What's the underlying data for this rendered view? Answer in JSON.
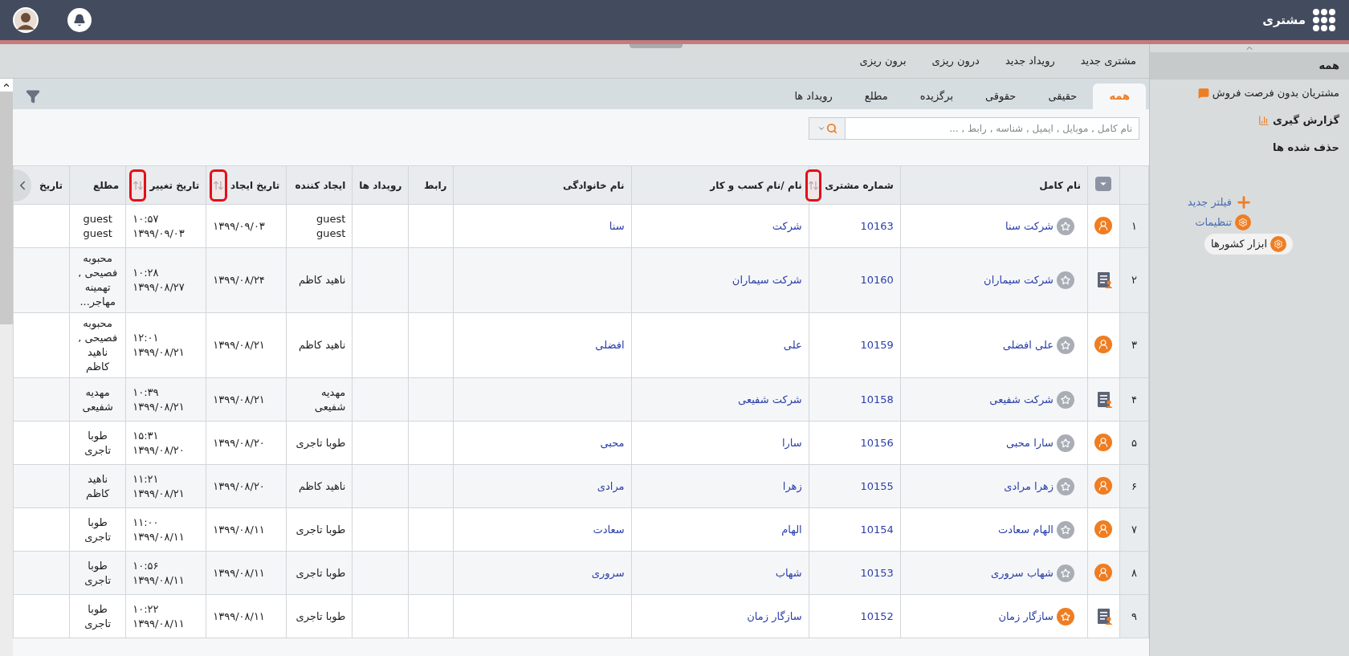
{
  "app": {
    "title": "مشتری"
  },
  "sidebar": {
    "items": [
      {
        "label": "همه",
        "selected": true,
        "kind": "plain"
      },
      {
        "label": "مشتریان بدون فرصت فروش",
        "selected": false,
        "kind": "chat"
      },
      {
        "label": "گزارش گیری",
        "selected": false,
        "kind": "report"
      },
      {
        "label": "حذف شده ها",
        "selected": false,
        "kind": "bold"
      }
    ],
    "links": [
      {
        "label": "فیلتر جدید",
        "kind": "add"
      },
      {
        "label": "تنظیمات",
        "kind": "settings"
      },
      {
        "label": "ابزار کشورها",
        "kind": "tool"
      }
    ]
  },
  "toolbar": [
    "مشتری جدید",
    "رویداد جدید",
    "درون ریزی",
    "برون ریزی"
  ],
  "tabs": [
    {
      "label": "همه",
      "selected": true
    },
    {
      "label": "حقیقی",
      "selected": false
    },
    {
      "label": "حقوقی",
      "selected": false
    },
    {
      "label": "برگزیده",
      "selected": false
    },
    {
      "label": "مطلع",
      "selected": false
    },
    {
      "label": "رویداد ها",
      "selected": false
    }
  ],
  "search": {
    "placeholder": "نام کامل , موبایل , ایمیل , شناسه , رابط , ..."
  },
  "table": {
    "columns": [
      {
        "label": "نام کامل",
        "sortable": false
      },
      {
        "label": "شماره مشتری",
        "sortable": true,
        "highlighted": true
      },
      {
        "label": "نام /نام کسب و کار",
        "sortable": false
      },
      {
        "label": "نام خانوادگی",
        "sortable": false
      },
      {
        "label": "رابط",
        "sortable": false
      },
      {
        "label": "رویداد ها",
        "sortable": false
      },
      {
        "label": "ایجاد کننده",
        "sortable": false
      },
      {
        "label": "تاریخ ایجاد",
        "sortable": true,
        "highlighted": true
      },
      {
        "label": "تاریخ تغییر",
        "sortable": true,
        "highlighted": true
      },
      {
        "label": "مطلع",
        "sortable": false
      },
      {
        "label": "تاریخ",
        "sortable": false
      }
    ],
    "rows": [
      {
        "num": "۱",
        "kind": "person",
        "favorite": false,
        "full_name": "شرکت سنا",
        "customer_no": "10163",
        "business_name": "شرکت",
        "family_name": "سنا",
        "creator": "guest guest",
        "created": "۱۳۹۹/۰۹/۰۳",
        "changed_time": "۱۰:۵۷",
        "changed_date": "۱۳۹۹/۰۹/۰۳",
        "related": "guest guest"
      },
      {
        "num": "۲",
        "kind": "company",
        "favorite": false,
        "full_name": "شرکت سیماران",
        "customer_no": "10160",
        "business_name": "شرکت سیماران",
        "creator": "ناهید کاظم",
        "created": "۱۳۹۹/۰۸/۲۴",
        "changed_time": "۱۰:۲۸",
        "changed_date": "۱۳۹۹/۰۸/۲۷",
        "related": "محبوبه فصیحی , تهمینه مهاجر..."
      },
      {
        "num": "۳",
        "kind": "person",
        "favorite": false,
        "full_name": "علی افضلی",
        "customer_no": "10159",
        "business_name": "علی",
        "family_name": "افضلی",
        "creator": "ناهید کاظم",
        "created": "۱۳۹۹/۰۸/۲۱",
        "changed_time": "۱۲:۰۱",
        "changed_date": "۱۳۹۹/۰۸/۲۱",
        "related": "محبوبه فصیحی , ناهید کاظم"
      },
      {
        "num": "۴",
        "kind": "company",
        "favorite": false,
        "full_name": "شرکت شفیعی",
        "customer_no": "10158",
        "business_name": "شرکت شفیعی",
        "creator": "مهدیه شفیعی",
        "created": "۱۳۹۹/۰۸/۲۱",
        "changed_time": "۱۰:۳۹",
        "changed_date": "۱۳۹۹/۰۸/۲۱",
        "related": "مهدیه شفیعی"
      },
      {
        "num": "۵",
        "kind": "person",
        "favorite": false,
        "full_name": "سارا محبی",
        "customer_no": "10156",
        "business_name": "سارا",
        "family_name": "محبی",
        "creator": "طوبا تاجری",
        "created": "۱۳۹۹/۰۸/۲۰",
        "changed_time": "۱۵:۳۱",
        "changed_date": "۱۳۹۹/۰۸/۲۰",
        "related": "طوبا تاجری"
      },
      {
        "num": "۶",
        "kind": "person",
        "favorite": false,
        "full_name": "زهرا مرادی",
        "customer_no": "10155",
        "business_name": "زهرا",
        "family_name": "مرادی",
        "creator": "ناهید کاظم",
        "created": "۱۳۹۹/۰۸/۲۰",
        "changed_time": "۱۱:۲۱",
        "changed_date": "۱۳۹۹/۰۸/۲۱",
        "related": "ناهید کاظم"
      },
      {
        "num": "۷",
        "kind": "person",
        "favorite": false,
        "full_name": "الهام سعادت",
        "customer_no": "10154",
        "business_name": "الهام",
        "family_name": "سعادت",
        "creator": "طوبا تاجری",
        "created": "۱۳۹۹/۰۸/۱۱",
        "changed_time": "۱۱:۰۰",
        "changed_date": "۱۳۹۹/۰۸/۱۱",
        "related": "طوبا تاجری"
      },
      {
        "num": "۸",
        "kind": "person",
        "favorite": false,
        "full_name": "شهاب سروری",
        "customer_no": "10153",
        "business_name": "شهاب",
        "family_name": "سروری",
        "creator": "طوبا تاجری",
        "created": "۱۳۹۹/۰۸/۱۱",
        "changed_time": "۱۰:۵۶",
        "changed_date": "۱۳۹۹/۰۸/۱۱",
        "related": "طوبا تاجری"
      },
      {
        "num": "۹",
        "kind": "company",
        "favorite": true,
        "full_name": "سازگار زمان",
        "customer_no": "10152",
        "business_name": "سازگار زمان",
        "creator": "طوبا تاجری",
        "created": "۱۳۹۹/۰۸/۱۱",
        "changed_time": "۱۰:۲۲",
        "changed_date": "۱۳۹۹/۰۸/۱۱",
        "related": "طوبا تاجری"
      }
    ]
  }
}
